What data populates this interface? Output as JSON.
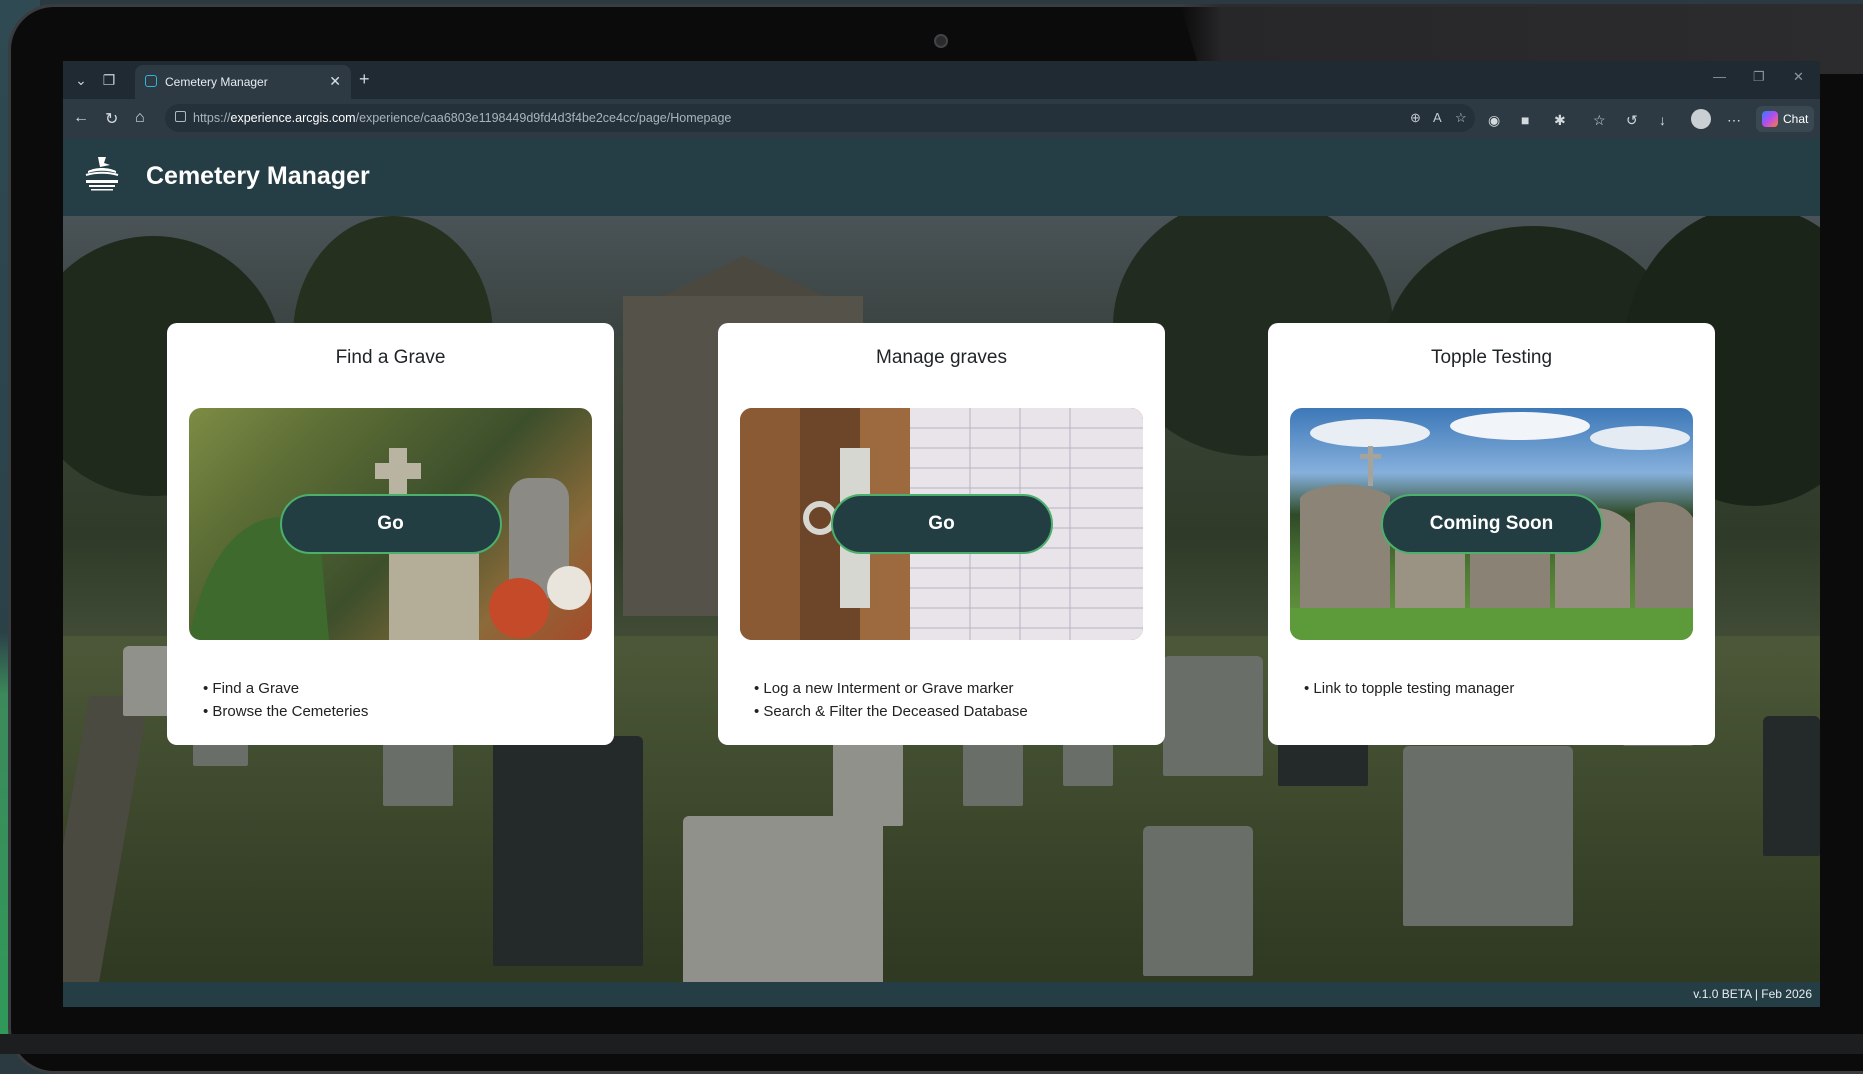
{
  "browser": {
    "tab_title": "Cemetery Manager",
    "url_prefix": "https://",
    "url_host": "experience.arcgis.com",
    "url_path": "/experience/caa6803e1198449d9fd4d3f4be2ce4cc/page/Homepage",
    "chat_label": "Chat"
  },
  "app": {
    "title": "Cemetery Manager"
  },
  "cards": [
    {
      "title": "Find a Grave",
      "button": "Go",
      "bullets": [
        "Find a Grave",
        "Browse the Cemeteries"
      ]
    },
    {
      "title": "Manage graves",
      "button": "Go",
      "bullets": [
        "Log a new Interment or Grave marker",
        "Search & Filter the Deceased Database"
      ]
    },
    {
      "title": "Topple Testing",
      "button": "Coming Soon",
      "bullets": [
        "Link to topple testing manager"
      ]
    }
  ],
  "footer": {
    "version": "v.1.0 BETA | Feb 2026"
  },
  "colors": {
    "header_bg": "#253e45",
    "button_bg": "#233e43",
    "button_border": "#4caf6b"
  }
}
